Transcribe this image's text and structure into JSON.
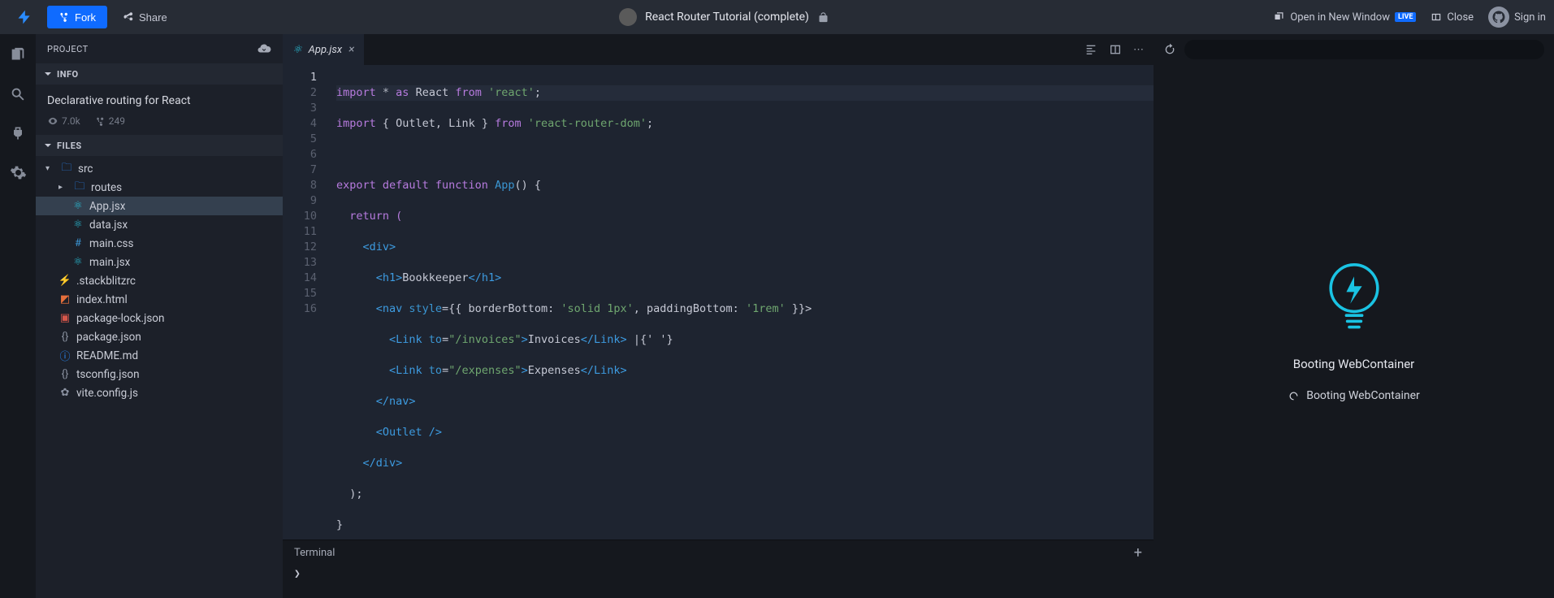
{
  "topbar": {
    "fork_label": "Fork",
    "share_label": "Share",
    "project_title": "React Router Tutorial (complete)",
    "open_new_window": "Open in New Window",
    "live_badge": "LIVE",
    "close_label": "Close",
    "signin_label": "Sign in"
  },
  "sidebar": {
    "project_label": "PROJECT",
    "info_label": "INFO",
    "files_label": "FILES",
    "description": "Declarative routing for React",
    "views": "7.0k",
    "forks": "249",
    "tree": {
      "src": "src",
      "routes": "routes",
      "app_jsx": "App.jsx",
      "data_jsx": "data.jsx",
      "main_css": "main.css",
      "main_jsx": "main.jsx",
      "stackblitzrc": ".stackblitzrc",
      "index_html": "index.html",
      "pkg_lock": "package-lock.json",
      "pkg_json": "package.json",
      "readme": "README.md",
      "tsconfig": "tsconfig.json",
      "vite_config": "vite.config.js"
    }
  },
  "editor": {
    "tab_label": "App.jsx",
    "line_numbers": [
      "1",
      "2",
      "3",
      "4",
      "5",
      "6",
      "7",
      "8",
      "9",
      "10",
      "11",
      "12",
      "13",
      "14",
      "15",
      "16"
    ],
    "code": {
      "l1_a": "import",
      "l1_b": " * ",
      "l1_c": "as",
      "l1_d": " React ",
      "l1_e": "from",
      "l1_f": " 'react'",
      "l1_g": ";",
      "l2_a": "import",
      "l2_b": " { Outlet, Link } ",
      "l2_c": "from",
      "l2_d": " 'react-router-dom'",
      "l2_e": ";",
      "l4_a": "export default function",
      "l4_b": " App",
      "l4_c": "() {",
      "l5": "  return (",
      "l6": "    <div>",
      "l7_a": "      <h1>",
      "l7_b": "Bookkeeper",
      "l7_c": "</h1>",
      "l8_a": "      <nav ",
      "l8_b": "style",
      "l8_c": "={{ borderBottom: ",
      "l8_d": "'solid 1px'",
      "l8_e": ", paddingBottom: ",
      "l8_f": "'1rem'",
      "l8_g": " }}>",
      "l9_a": "        <Link ",
      "l9_b": "to",
      "l9_c": "=",
      "l9_d": "\"/invoices\"",
      "l9_e": ">",
      "l9_f": "Invoices",
      "l9_g": "</Link>",
      " l9_h": " |{' '}",
      "l10_a": "        <Link ",
      "l10_b": "to",
      "l10_c": "=",
      "l10_d": "\"/expenses\"",
      "l10_e": ">",
      "l10_f": "Expenses",
      "l10_g": "</Link>",
      "l11": "      </nav>",
      "l12": "      <Outlet />",
      "l13": "    </div>",
      "l14": "  );",
      "l15": "}"
    }
  },
  "terminal": {
    "title": "Terminal",
    "prompt": "❯"
  },
  "preview": {
    "boot_title": "Booting WebContainer",
    "boot_sub": "Booting WebContainer"
  }
}
